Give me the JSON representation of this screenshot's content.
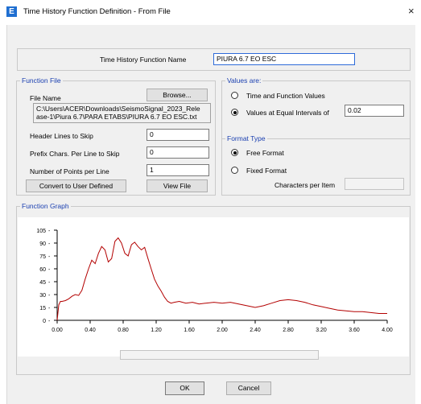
{
  "window": {
    "icon_letter": "E",
    "title": "Time History Function Definition  - From File",
    "close_glyph": "×"
  },
  "name_row": {
    "label": "Time History Function Name",
    "value": "PIURA 6.7 EO ESC"
  },
  "function_file": {
    "group_title": "Function File",
    "file_name_label": "File Name",
    "browse_label": "Browse...",
    "path_line1": "C:\\Users\\ACER\\Downloads\\SeismoSignal_2023_Rele",
    "path_line2": "ase-1\\Piura 6.7\\PARA ETABS\\PIURA 6.7 EO ESC.txt",
    "header_lines_label": "Header Lines to Skip",
    "header_lines_value": "0",
    "prefix_chars_label": "Prefix Chars. Per Line to Skip",
    "prefix_chars_value": "0",
    "points_per_line_label": "Number of Points per Line",
    "points_per_line_value": "1",
    "convert_label": "Convert to User Defined",
    "view_file_label": "View File"
  },
  "values_are": {
    "group_title": "Values are:",
    "option_time_function": "Time and Function Values",
    "option_equal_intervals": "Values at Equal Intervals of",
    "selected": "equal_intervals",
    "interval_value": "0.02"
  },
  "format_type": {
    "group_title": "Format Type",
    "option_free": "Free Format",
    "option_fixed": "Fixed Format",
    "selected": "free",
    "chars_per_item_label": "Characters per Item"
  },
  "function_graph": {
    "group_title": "Function Graph"
  },
  "chart_data": {
    "type": "line",
    "xlim": [
      0,
      4.0
    ],
    "ylim": [
      0,
      105
    ],
    "x_ticks": [
      "0.00",
      "0.40",
      "0.80",
      "1.20",
      "1.60",
      "2.00",
      "2.40",
      "2.80",
      "3.20",
      "3.60",
      "4.00"
    ],
    "x_tick_values": [
      0,
      0.4,
      0.8,
      1.2,
      1.6,
      2.0,
      2.4,
      2.8,
      3.2,
      3.6,
      4.0
    ],
    "y_ticks": [
      "0",
      "15",
      "30",
      "45",
      "60",
      "75",
      "90",
      "105"
    ],
    "y_tick_values": [
      0,
      15,
      30,
      45,
      60,
      75,
      90,
      105
    ],
    "line_color": "#b30000",
    "series": [
      {
        "x": [
          0.0,
          0.02,
          0.04,
          0.06,
          0.1,
          0.14,
          0.18,
          0.22,
          0.26,
          0.3,
          0.34,
          0.38,
          0.42,
          0.46,
          0.5,
          0.54,
          0.58,
          0.62,
          0.66,
          0.7,
          0.74,
          0.78,
          0.82,
          0.86,
          0.9,
          0.94,
          0.98,
          1.02,
          1.06,
          1.1,
          1.14,
          1.18,
          1.22,
          1.26,
          1.3,
          1.34,
          1.38,
          1.42,
          1.48,
          1.56,
          1.64,
          1.72,
          1.8,
          1.9,
          2.0,
          2.1,
          2.2,
          2.3,
          2.4,
          2.5,
          2.6,
          2.7,
          2.8,
          2.9,
          3.0,
          3.1,
          3.2,
          3.3,
          3.4,
          3.5,
          3.6,
          3.7,
          3.8,
          3.9,
          4.0
        ],
        "y": [
          0,
          18,
          22,
          22,
          23,
          25,
          28,
          30,
          29,
          35,
          48,
          60,
          70,
          66,
          78,
          86,
          82,
          68,
          72,
          92,
          96,
          90,
          78,
          75,
          88,
          91,
          86,
          82,
          85,
          72,
          60,
          48,
          40,
          34,
          27,
          22,
          20,
          21,
          22,
          20,
          21,
          19,
          20,
          21,
          20,
          21,
          19,
          17,
          15,
          17,
          20,
          23,
          24,
          23,
          21,
          18,
          16,
          14,
          12,
          11,
          10,
          10,
          9,
          8,
          8
        ]
      }
    ]
  },
  "footer": {
    "ok_label": "OK",
    "cancel_label": "Cancel"
  }
}
